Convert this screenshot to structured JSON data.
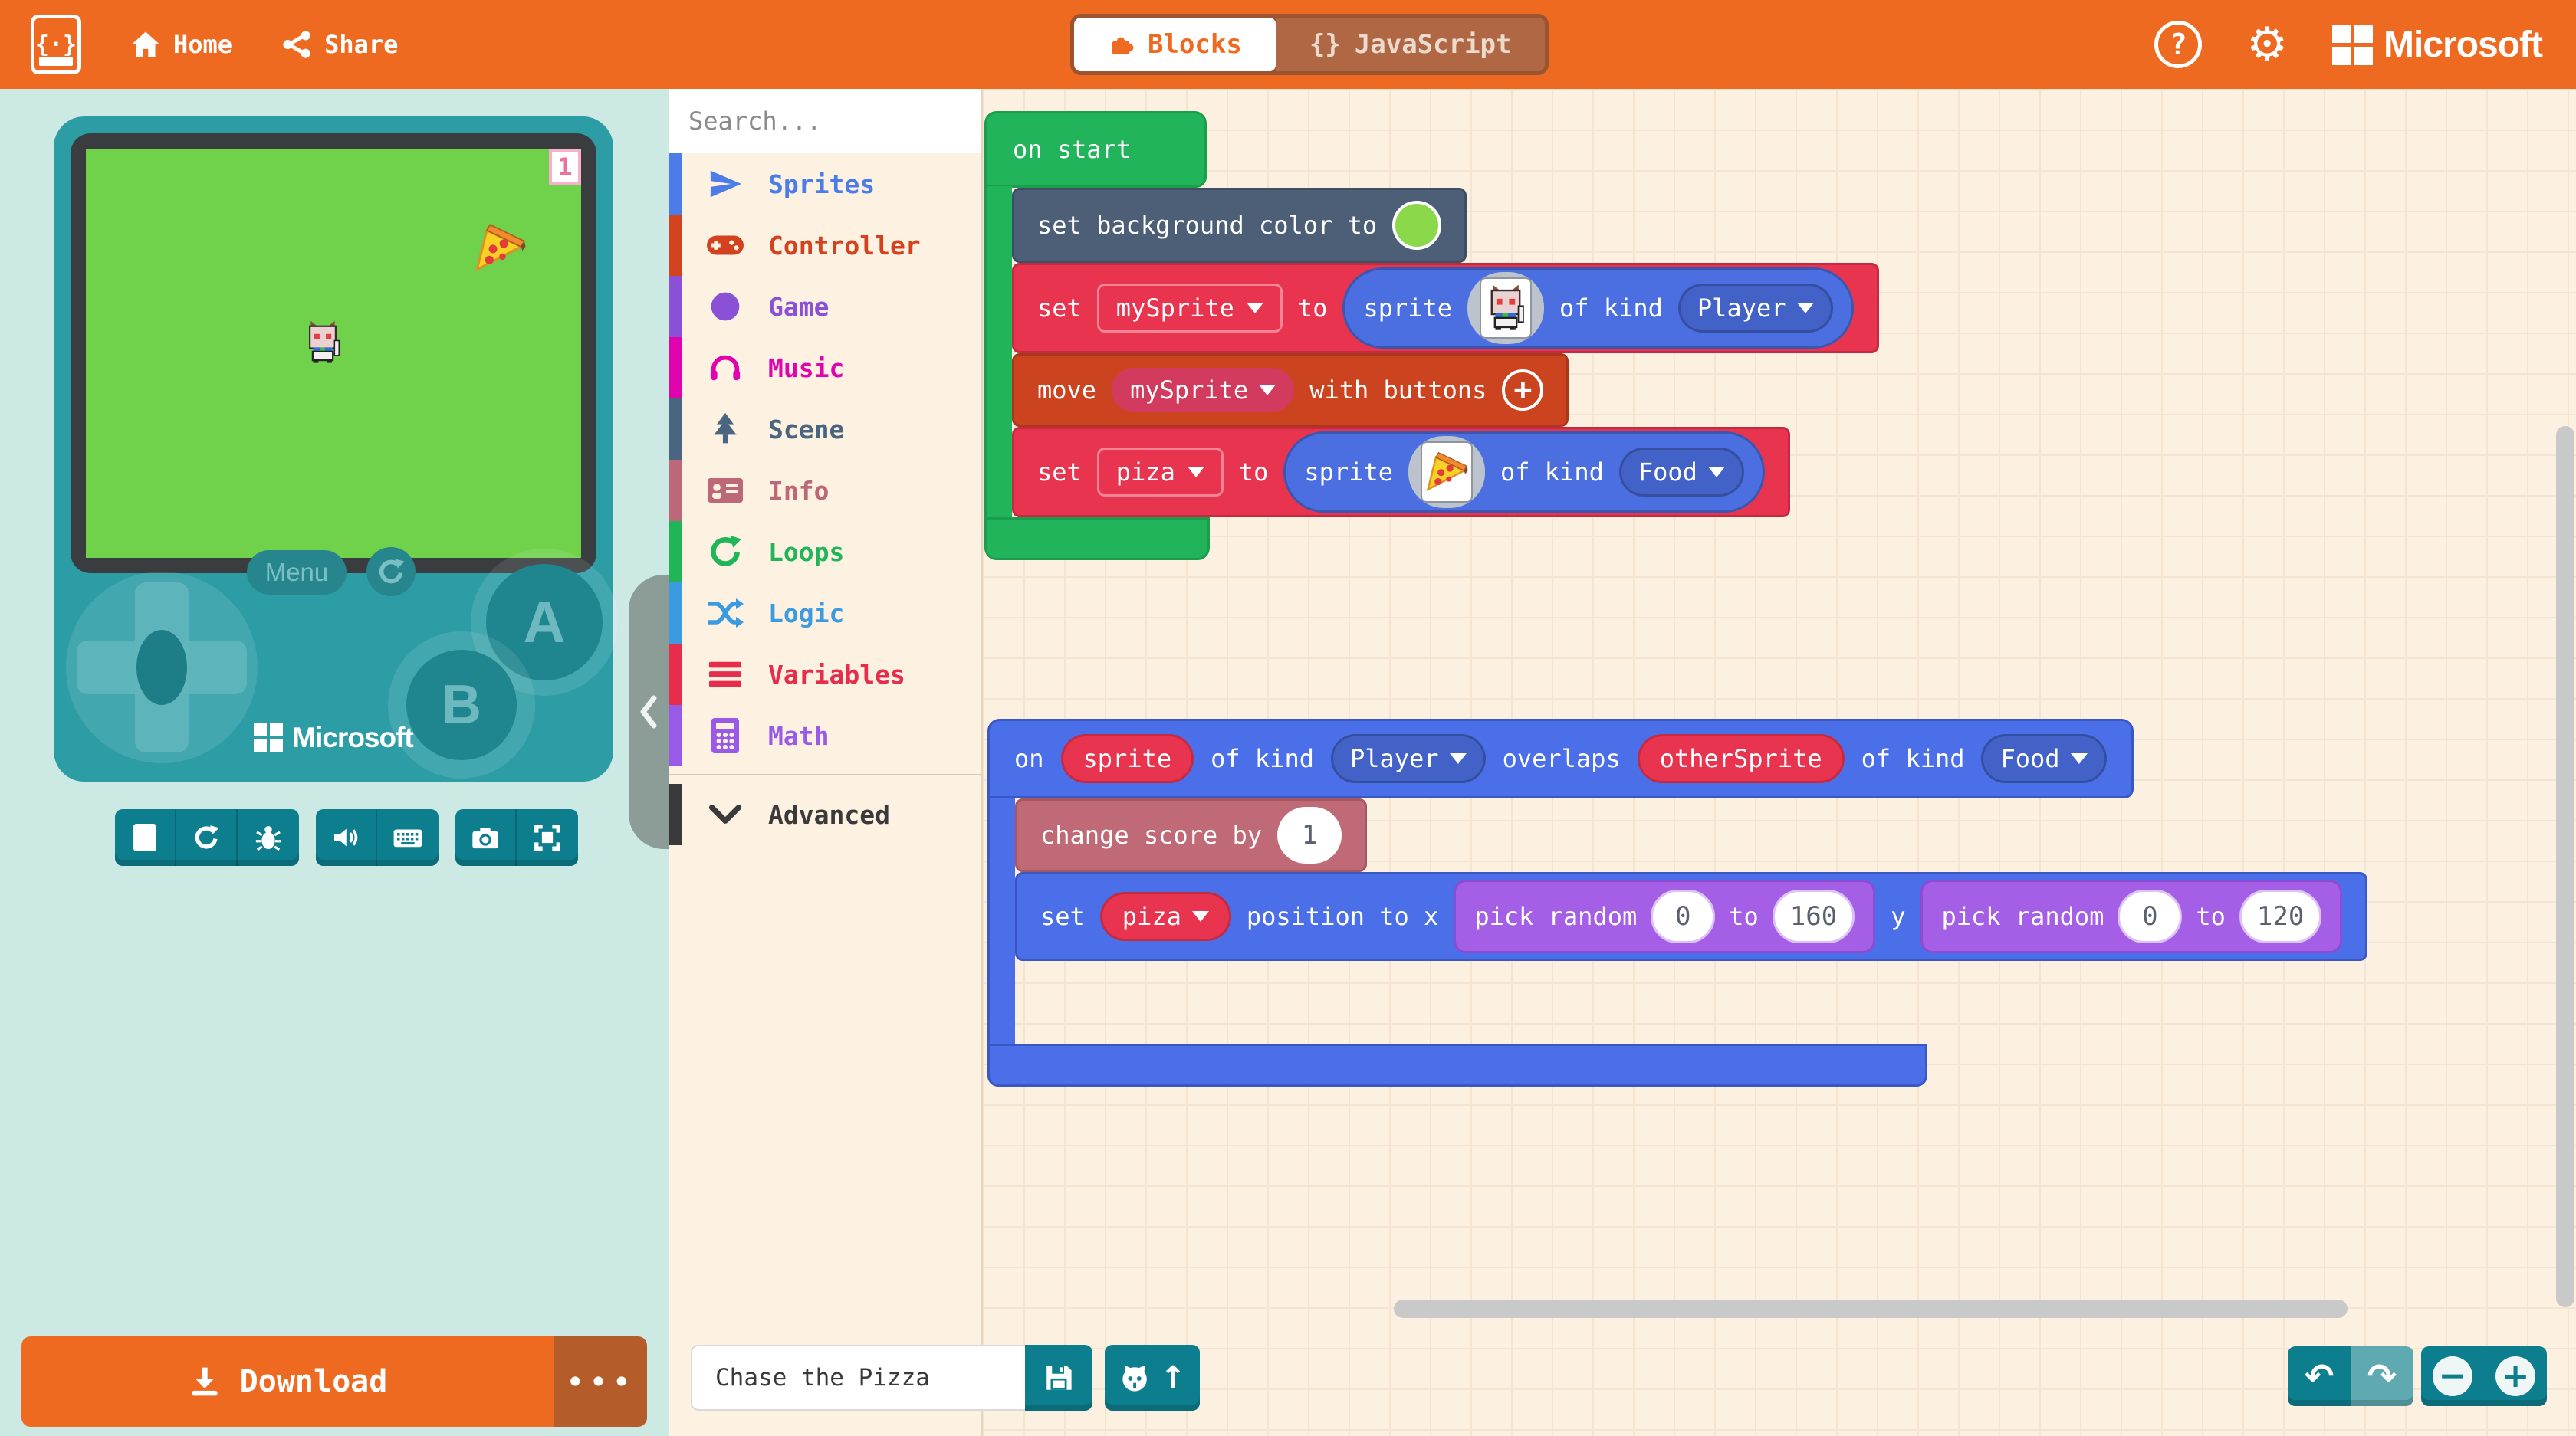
{
  "colors": {
    "header_bg": "#ee6a21",
    "teal_button": "#0d7e8e",
    "console_teal": "#2d9da5",
    "panel_mint": "#cde9e4",
    "workspace_bg": "#fcf1e1",
    "screen_green": "#70d14b",
    "block_green": "#22b45a",
    "block_slate": "#4c5f77",
    "block_crimson": "#e8344f",
    "block_orange": "#cc4320",
    "block_blue": "#4b6fe8",
    "block_mauve": "#c06a77",
    "block_purple": "#a45fe6"
  },
  "icons": {
    "help": "?",
    "gear": "⚙",
    "dots": "•••",
    "undo": "↶",
    "redo": "↷",
    "plus": "+",
    "minus": "−",
    "braces": "{}",
    "github_arrow": "↑"
  },
  "header": {
    "home_label": "Home",
    "share_label": "Share",
    "blocks_tab": "Blocks",
    "javascript_tab": "JavaScript",
    "brand": "Microsoft"
  },
  "simulator": {
    "score": "1",
    "menu_label": "Menu",
    "button_a": "A",
    "button_b": "B",
    "brand": "Microsoft"
  },
  "download": {
    "label": "Download"
  },
  "project": {
    "name": "Chase the Pizza"
  },
  "toolbox": {
    "search_placeholder": "Search...",
    "categories": [
      {
        "label": "Sprites",
        "color": "#4b7ce8"
      },
      {
        "label": "Controller",
        "color": "#d3421f"
      },
      {
        "label": "Game",
        "color": "#8a50d6"
      },
      {
        "label": "Music",
        "color": "#e103ac"
      },
      {
        "label": "Scene",
        "color": "#4a6580"
      },
      {
        "label": "Info",
        "color": "#bc6879"
      },
      {
        "label": "Loops",
        "color": "#1fb558"
      },
      {
        "label": "Logic",
        "color": "#3b9ae0"
      },
      {
        "label": "Variables",
        "color": "#e62e4c"
      },
      {
        "label": "Math",
        "color": "#9a5ae8"
      }
    ],
    "advanced_label": "Advanced"
  },
  "blocks": {
    "on_start": {
      "title": "on start",
      "set_bg_prefix": "set background color to",
      "set_sprite": {
        "kw": "set",
        "var": "mySprite",
        "to": "to",
        "sprite_kw": "sprite",
        "of_kind": "of kind",
        "kind": "Player"
      },
      "move": {
        "kw": "move",
        "var": "mySprite",
        "suffix": "with buttons"
      },
      "set_food": {
        "kw": "set",
        "var": "piza",
        "to": "to",
        "sprite_kw": "sprite",
        "of_kind": "of kind",
        "kind": "Food"
      }
    },
    "on_overlap": {
      "kw_on": "on",
      "arg1": "sprite",
      "of_kind1": "of kind",
      "kind1": "Player",
      "kw_overlaps": "overlaps",
      "arg2": "otherSprite",
      "of_kind2": "of kind",
      "kind2": "Food",
      "change_score": {
        "label": "change score by",
        "value": "1"
      },
      "set_position": {
        "kw": "set",
        "var": "piza",
        "label": "position to x",
        "pick1": {
          "label": "pick random",
          "from": "0",
          "to_word": "to",
          "to": "160"
        },
        "y_label": "y",
        "pick2": {
          "label": "pick random",
          "from": "0",
          "to_word": "to",
          "to": "120"
        }
      }
    }
  }
}
